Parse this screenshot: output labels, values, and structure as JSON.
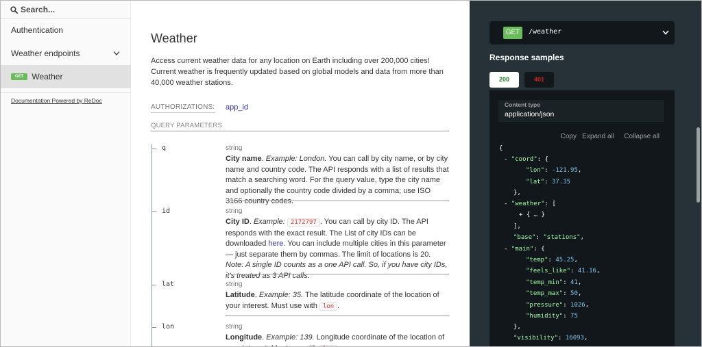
{
  "search": {
    "placeholder": "Search..."
  },
  "sidebar": {
    "items": [
      {
        "label": "Authentication"
      },
      {
        "label": "Weather endpoints"
      },
      {
        "label": "Weather",
        "method": "GET"
      }
    ],
    "footer_link": "Documentation Powered by ReDoc"
  },
  "main": {
    "title": "Weather",
    "description": "Access current weather data for any location on Earth including over 200,000 cities! Current weather is frequently updated based on global models and data from more than 40,000 weather stations.",
    "authorizations_label": "AUTHORIZATIONS:",
    "authorizations_value": "app_id",
    "query_params_label": "QUERY PARAMETERS",
    "params": [
      {
        "name": "q",
        "type": "string",
        "title": "City name",
        "example_label": "Example:",
        "example": "London.",
        "text": " You can call by city name, or by city name and country code. The API responds with a list of results that match a searching word. For the query value, type the city name and optionally the country code divided by a comma; use ISO 3166 country codes."
      },
      {
        "name": "id",
        "type": "string",
        "title": "City ID",
        "example_label": "Example:",
        "example_code": "2172797",
        "text1": ". You can call by city ID. The API responds with the exact result. The List of city IDs can be downloaded ",
        "link": "here",
        "text2": ". You can include multiple cities in this parameter — just separate them by commas. The limit of locations is 20.",
        "note": "Note: A single ID counts as a one API call. So, if you have city IDs, it's treated as 3 API calls."
      },
      {
        "name": "lat",
        "type": "string",
        "title": "Latitude",
        "example_label": "Example:",
        "example": "35.",
        "text": " The latitude coordinate of the location of your interest. Must use with ",
        "code": "lon",
        "end": "."
      },
      {
        "name": "lon",
        "type": "string",
        "title": "Longitude",
        "example_label": "Example:",
        "example": "139.",
        "text": " Longitude coordinate of the location of your interest. Must use with ",
        "code": "lat"
      }
    ]
  },
  "right": {
    "method": "GET",
    "path": "/weather",
    "response_title": "Response samples",
    "tabs": [
      "200",
      "401"
    ],
    "content_type_label": "Content type",
    "content_type_value": "application/json",
    "tools": [
      "Copy",
      "Expand all",
      "Collapse all"
    ],
    "json_lines": {
      "open": "{",
      "coord_key": "\"coord\"",
      "lon_key": "\"lon\"",
      "lon_val": "-121.95",
      "lat_key": "\"lat\"",
      "lat_val": "37.35",
      "weather_key": "\"weather\"",
      "collapsed": "{ … }",
      "base_key": "\"base\"",
      "base_val": "\"stations\"",
      "main_key": "\"main\"",
      "temp_key": "\"temp\"",
      "temp_val": "45.25",
      "feels_key": "\"feels_like\"",
      "feels_val": "41.16",
      "tmin_key": "\"temp_min\"",
      "tmin_val": "41",
      "tmax_key": "\"temp_max\"",
      "tmax_val": "50",
      "pressure_key": "\"pressure\"",
      "pressure_val": "1026",
      "humidity_key": "\"humidity\"",
      "humidity_val": "75",
      "visibility_key": "\"visibility\"",
      "visibility_val": "16093"
    }
  },
  "colors": {
    "get_green": "#6bbd5b",
    "dark_panel": "#263238",
    "code_bg": "#11171a",
    "json_key": "#a0fbaa",
    "json_number": "#86c3e8",
    "link": "#32329f",
    "error_red": "#d41f1c",
    "ok_green": "#1d8127"
  }
}
